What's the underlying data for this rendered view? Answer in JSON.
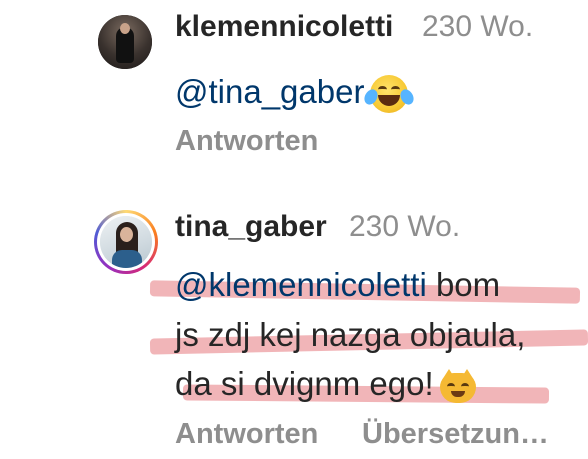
{
  "comments": [
    {
      "username": "klemennicoletti",
      "time": "230 Wo.",
      "mention": "@tina_gaber",
      "emoji": "face-with-tears-of-joy",
      "reply_label": "Antworten"
    },
    {
      "username": "tina_gaber",
      "time": "230 Wo.",
      "mention": "@klemennicoletti",
      "text_line1_rest": " bom",
      "text_line2": "js zdj kej nazga objaula,",
      "text_line3": "da si dvignm ego!",
      "emoji": "grinning-cat",
      "reply_label": "Antworten",
      "translate_label": "Übersetzun…"
    }
  ],
  "highlight_color": "#e6787d"
}
